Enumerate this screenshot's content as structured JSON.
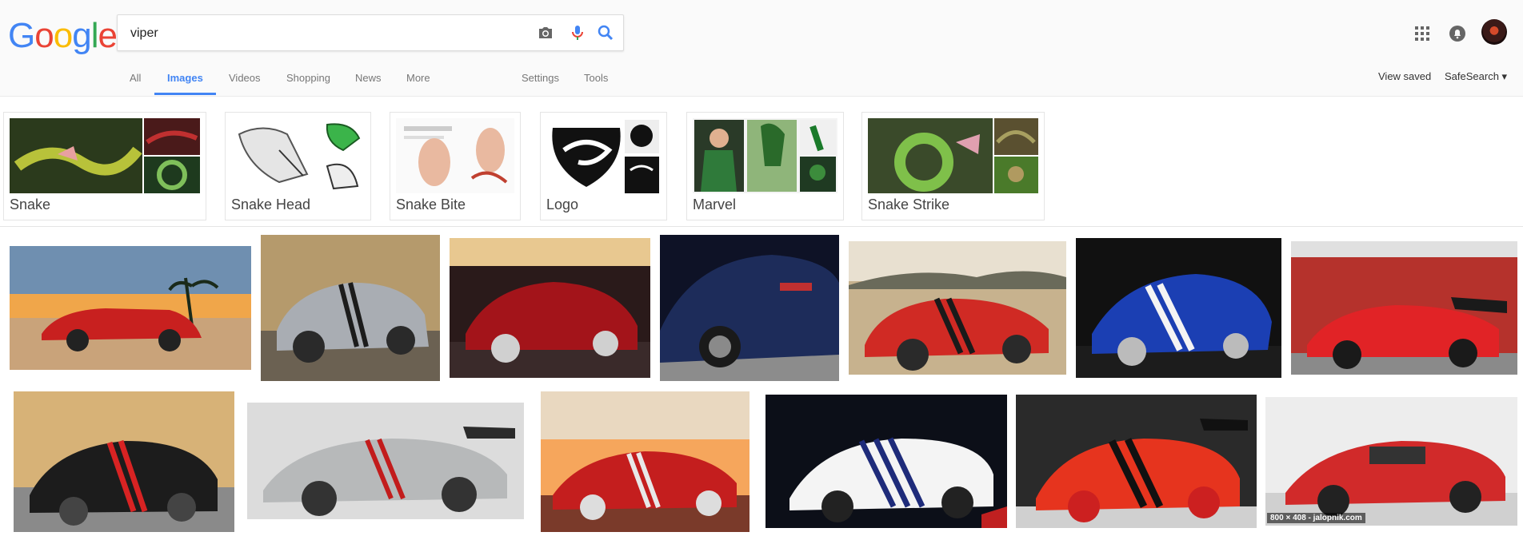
{
  "logo": {
    "letters": [
      "G",
      "o",
      "o",
      "g",
      "l",
      "e"
    ],
    "colors": [
      "#4285f4",
      "#ea4335",
      "#fbbc05",
      "#4285f4",
      "#34a853",
      "#ea4335"
    ]
  },
  "search": {
    "query": "viper"
  },
  "tabs": [
    {
      "label": "All"
    },
    {
      "label": "Images"
    },
    {
      "label": "Videos"
    },
    {
      "label": "Shopping"
    },
    {
      "label": "News"
    },
    {
      "label": "More"
    }
  ],
  "tools": {
    "settings": "Settings",
    "tools": "Tools"
  },
  "rightnav": {
    "view_saved": "View saved",
    "safesearch": "SafeSearch ▾"
  },
  "related": [
    {
      "label": "Snake"
    },
    {
      "label": "Snake Head"
    },
    {
      "label": "Snake Bite"
    },
    {
      "label": "Logo"
    },
    {
      "label": "Marvel"
    },
    {
      "label": "Snake Strike"
    }
  ],
  "images": {
    "row1": [
      {
        "body": "#c8201f",
        "bg": "#f0a64a",
        "stripe": "none"
      },
      {
        "body": "#a9adb3",
        "bg": "#b59a6c",
        "stripe": "#1c1c1c"
      },
      {
        "body": "#a3141a",
        "bg": "#2a1a1a",
        "stripe": "none"
      },
      {
        "body": "#1d2c5a",
        "bg": "#0e1226",
        "stripe": "none"
      },
      {
        "body": "#d02a24",
        "bg": "#c7b28e",
        "stripe": "#1a1a1a"
      },
      {
        "body": "#1b3fb3",
        "bg": "#111111",
        "stripe": "#f4f4f4"
      },
      {
        "body": "#e12326",
        "bg": "#b5322c",
        "stripe": "none"
      }
    ],
    "row2": [
      {
        "body": "#1c1c1c",
        "bg": "#d7b277",
        "stripe": "#d82323"
      },
      {
        "body": "#b7b9ba",
        "bg": "#dcdcdc",
        "stripe": "#c21c1c"
      },
      {
        "body": "#c41e1e",
        "bg": "#f6a65c",
        "stripe": "#e8e8e8"
      },
      {
        "body": "#f4f4f4",
        "bg": "#0c0f18",
        "stripe": "#1e2b7a"
      },
      {
        "body": "#e6341e",
        "bg": "#2a2a2a",
        "stripe": "#111111"
      },
      {
        "body": "#d12a2a",
        "bg": "#ededed",
        "stripe": "none"
      }
    ],
    "caption": "800 × 408 - jalopnik.com"
  }
}
